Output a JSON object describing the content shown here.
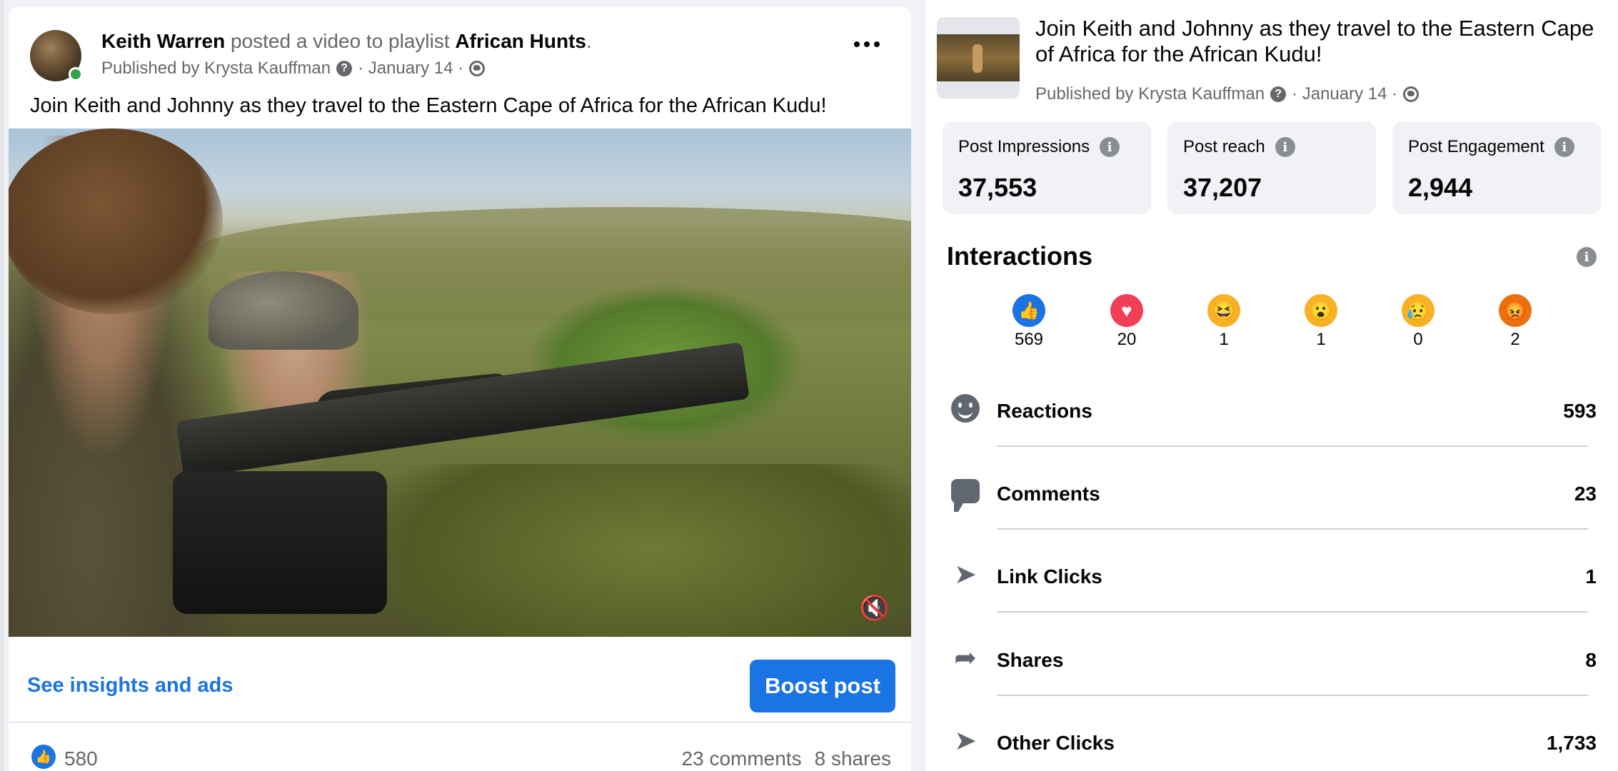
{
  "post": {
    "author": "Keith Warren",
    "action_text": " posted a video to playlist ",
    "playlist": "African Hunts",
    "period": ".",
    "published_by": "Published by Krysta Kauffman",
    "date": "· January 14 ·",
    "text": "Join Keith and Johnny as they travel to the Eastern Cape of Africa for the African Kudu!",
    "see_insights_label": "See insights and ads",
    "boost_label": "Boost post",
    "like_count": "580",
    "comments_count": "23 comments",
    "shares_count": "8 shares"
  },
  "panel": {
    "title": "Join Keith and Johnny as they travel to the Eastern Cape of Africa for the African Kudu!",
    "published_by": "Published by Krysta Kauffman",
    "date": "· January 14 ·",
    "metrics": [
      {
        "label": "Post Impressions",
        "value": "37,553"
      },
      {
        "label": "Post reach",
        "value": "37,207"
      },
      {
        "label": "Post Engagement",
        "value": "2,944"
      }
    ],
    "interactions_title": "Interactions",
    "reactions": [
      {
        "name": "like",
        "count": "569"
      },
      {
        "name": "love",
        "count": "20"
      },
      {
        "name": "haha",
        "count": "1"
      },
      {
        "name": "wow",
        "count": "1"
      },
      {
        "name": "sad",
        "count": "0"
      },
      {
        "name": "angry",
        "count": "2"
      }
    ],
    "rows": [
      {
        "label": "Reactions",
        "value": "593",
        "icon": "smile-icon"
      },
      {
        "label": "Comments",
        "value": "23",
        "icon": "comment-icon"
      },
      {
        "label": "Link Clicks",
        "value": "1",
        "icon": "cursor-icon"
      },
      {
        "label": "Shares",
        "value": "8",
        "icon": "share-icon"
      },
      {
        "label": "Other Clicks",
        "value": "1,733",
        "icon": "cursor-icon"
      }
    ]
  },
  "colors": {
    "accent": "#1b74e4",
    "online": "#31a24c",
    "love": "#f33e58",
    "emoji": "#f7b125"
  }
}
